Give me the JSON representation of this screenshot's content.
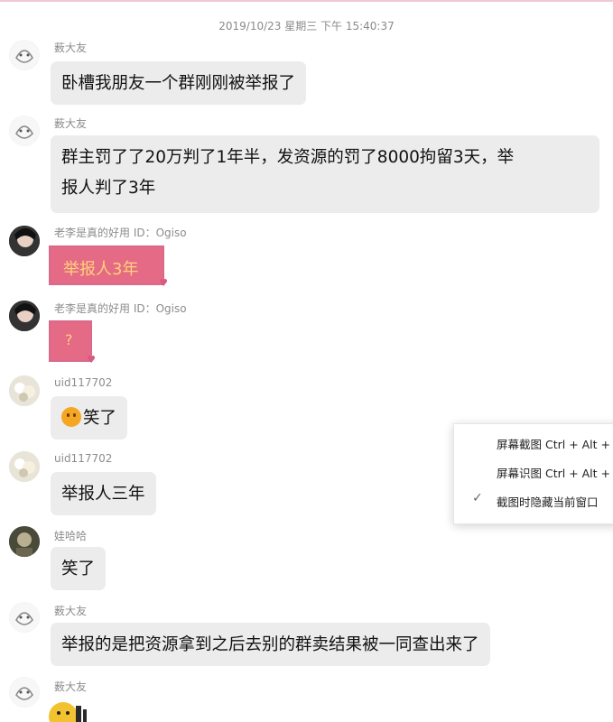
{
  "timestamp": "2019/10/23 星期三 下午 15:40:37",
  "messages": [
    {
      "sender": "薮大友",
      "text": "卧槽我朋友一个群刚刚被举报了"
    },
    {
      "sender": "薮大友",
      "line1": "群主罚了了20万判了1年半，发资源的罚了8000拘留3天，举",
      "line2": "报人判了3年"
    },
    {
      "sender": "老李是真的好用 ID：Ogiso",
      "sticker_text": "举报人3年"
    },
    {
      "sender": "老李是真的好用 ID：Ogiso",
      "sticker_text": "?"
    },
    {
      "sender": "uid117702",
      "text": "笑了"
    },
    {
      "sender": "uid117702",
      "text": "举报人三年"
    },
    {
      "sender": "娃哈哈",
      "text": "笑了"
    },
    {
      "sender": "薮大友",
      "text": "举报的是把资源拿到之后去别的群卖结果被一同查出来了"
    },
    {
      "sender": "薮大友"
    }
  ],
  "context_menu": {
    "items": [
      "屏幕截图 Ctrl + Alt +",
      "屏幕识图 Ctrl + Alt +",
      "截图时隐藏当前窗口"
    ],
    "checked_index": 2
  }
}
